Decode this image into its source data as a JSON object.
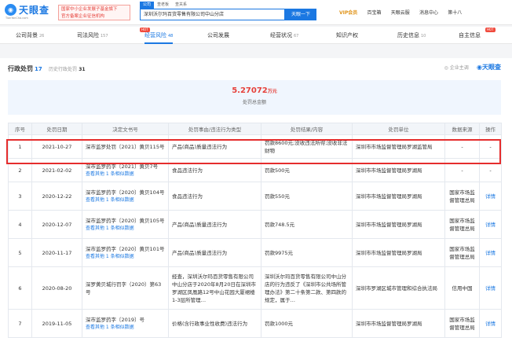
{
  "header": {
    "logo_text": "天眼查",
    "logo_sub": "TianYanCha.com",
    "badge_line1": "国家中小企业发展子基金旗下",
    "badge_line2": "官方备案企业征信机构",
    "search_tabs": [
      "公司",
      "查老板",
      "查关系"
    ],
    "search_value": "深圳沃尔玛百货零售有限公司中山分店",
    "search_button": "天眼一下",
    "nav": [
      "VIP会员",
      "百宝箱",
      "天眼云服",
      "消息中心",
      "第十八"
    ]
  },
  "tabs": [
    {
      "label": "公司背景",
      "count": "26"
    },
    {
      "label": "司法风险",
      "count": "157"
    },
    {
      "label": "经营风险",
      "count": "48"
    },
    {
      "label": "公司发展",
      "count": ""
    },
    {
      "label": "经营状况",
      "count": "67"
    },
    {
      "label": "知识产权",
      "count": ""
    },
    {
      "label": "历史信息",
      "count": "10"
    },
    {
      "label": "自主信息",
      "count": ""
    }
  ],
  "section": {
    "title": "行政处罚",
    "count": "17",
    "history_label": "历史行政处罚",
    "history_count": "31",
    "qz_label": "企业主调",
    "brand": "天眼查",
    "total_value": "5.27072",
    "total_unit": "万元",
    "total_label": "处罚总金额"
  },
  "table": {
    "headers": [
      "序号",
      "处罚日期",
      "决定文书号",
      "处罚事由/违法行为类型",
      "处罚结果/内容",
      "处罚单位",
      "数据来源",
      "操作"
    ],
    "rows": [
      {
        "idx": "1",
        "date": "2021-10-27",
        "doc": "深市监罗处罚〔2021〕黄贝115号",
        "more": "",
        "reason": "产品(商品)质量违法行为",
        "result": "罚款8600元;没收违法所得;没收非法财物",
        "unit": "深圳市市场监督管理局罗湖监管局",
        "source": "-",
        "op": "-"
      },
      {
        "idx": "2",
        "date": "2021-02-02",
        "doc": "深市监罗药字〔2021〕黄贝7号",
        "more": "查看其他 1 条相似数据",
        "reason": "食品违法行为",
        "result": "罚款500元",
        "unit": "深圳市市场监督管理局罗湖局",
        "source": "-",
        "op": "-"
      },
      {
        "idx": "3",
        "date": "2020-12-22",
        "doc": "深市监罗药字〔2020〕黄贝104号",
        "more": "查看其他 1 条相似数据",
        "reason": "食品违法行为",
        "result": "罚款550元",
        "unit": "深圳市市场监督管理局罗湖局",
        "source": "国家市场监督管理总局",
        "op": "详情"
      },
      {
        "idx": "4",
        "date": "2020-12-07",
        "doc": "深市监罗药字〔2020〕黄贝105号",
        "more": "查看其他 1 条相似数据",
        "reason": "产品(商品)质量违法行为",
        "result": "罚款748.5元",
        "unit": "深圳市市场监督管理局罗湖局",
        "source": "国家市场监督管理总局",
        "op": "详情"
      },
      {
        "idx": "5",
        "date": "2020-11-17",
        "doc": "深市监罗药字〔2020〕黄贝101号",
        "more": "查看其他 1 条相似数据",
        "reason": "产品(商品)质量违法行为",
        "result": "罚款9975元",
        "unit": "深圳市市场监督管理局罗湖局",
        "source": "国家市场监督管理总局",
        "op": "详情"
      },
      {
        "idx": "6",
        "date": "2020-08-20",
        "doc": "深罗黄贝城行罚字（2020）第63号",
        "more": "",
        "reason": "经查，深圳沃尔玛百货零售有限公司中山分店于2020年8月20日在深圳市罗湖区凤凰路12号中山花园大厦裙楼1-3层所管理…",
        "result": "深圳沃尔玛百货零售有限公司中山分店的行为违反了《深圳市公共场所管理办法》第二十条第二款、第四款的规定，属于…",
        "unit": "深圳市罗湖区城市管理和综合执法局",
        "source": "信用中国",
        "op": "详情"
      },
      {
        "idx": "7",
        "date": "2019-11-05",
        "doc": "深市监罗药字〔2019〕号",
        "more": "查看其他 1 条相似数据",
        "reason": "价格(含行政事业性收费)违法行为",
        "result": "罚款1000元",
        "unit": "深圳市市场监督管理局罗湖局",
        "source": "国家市场监督管理总局",
        "op": "详情"
      }
    ]
  }
}
